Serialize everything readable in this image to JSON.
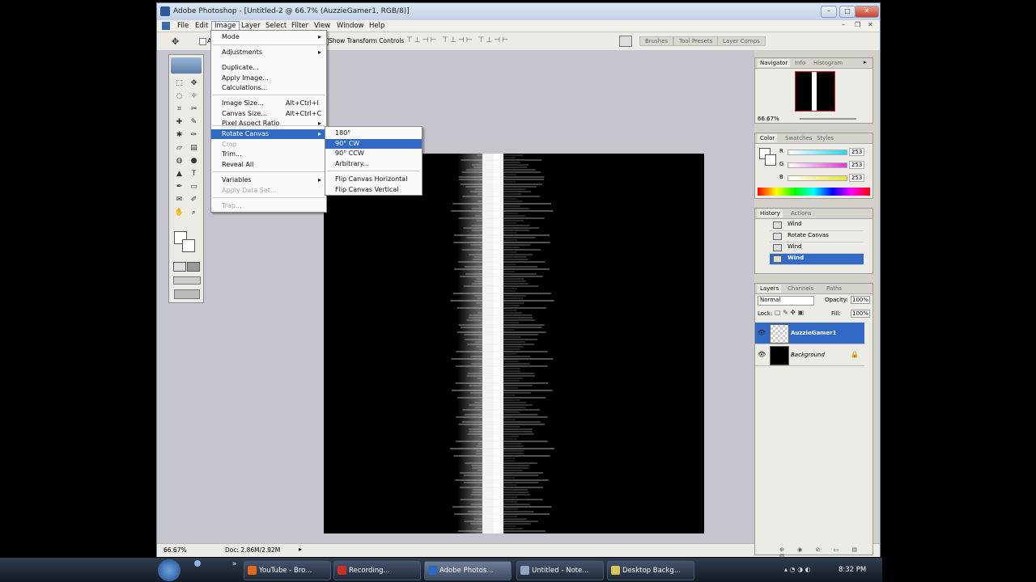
{
  "window": {
    "title": "Adobe Photoshop - [Untitled-2 @ 66.7% (AuzzieGamer1, RGB/8)]",
    "min": "–",
    "max": "□",
    "close": "✕"
  },
  "doc_controls": {
    "min": "–",
    "restore": "❐",
    "close": "✕"
  },
  "menubar": [
    "File",
    "Edit",
    "Image",
    "Layer",
    "Select",
    "Filter",
    "View",
    "Window",
    "Help"
  ],
  "options": {
    "show_transform": "Show Transform Controls",
    "auto_prefix": "A",
    "tabs": [
      "Brushes",
      "Tool Presets",
      "Layer Comps"
    ]
  },
  "image_menu": {
    "items": [
      {
        "label": "Mode",
        "arrow": "▸"
      },
      {
        "label": "Adjustments",
        "arrow": "▸"
      },
      {
        "label": "Duplicate..."
      },
      {
        "label": "Apply Image..."
      },
      {
        "label": "Calculations..."
      },
      {
        "label": "Image Size...",
        "shortcut": "Alt+Ctrl+I"
      },
      {
        "label": "Canvas Size...",
        "shortcut": "Alt+Ctrl+C"
      },
      {
        "label": "Pixel Aspect Ratio",
        "arrow": "▸"
      },
      {
        "label": "Rotate Canvas",
        "arrow": "▸"
      },
      {
        "label": "Crop"
      },
      {
        "label": "Trim..."
      },
      {
        "label": "Reveal All"
      },
      {
        "label": "Variables",
        "arrow": "▸"
      },
      {
        "label": "Apply Data Set..."
      },
      {
        "label": "Trap..."
      }
    ]
  },
  "rotate_submenu": {
    "items": [
      "180°",
      "90° CW",
      "90° CCW",
      "Arbitrary...",
      "Flip Canvas Horizontal",
      "Flip Canvas Vertical"
    ]
  },
  "navigator": {
    "tabs": [
      "Navigator",
      "Info",
      "Histogram"
    ],
    "zoom": "66.67%"
  },
  "color": {
    "tabs": [
      "Color",
      "Swatches",
      "Styles"
    ],
    "channels": [
      {
        "name": "R",
        "value": "253",
        "color": "#27d6e8"
      },
      {
        "name": "G",
        "value": "253",
        "color": "#e03ad5"
      },
      {
        "name": "B",
        "value": "253",
        "color": "#e8e23a"
      }
    ]
  },
  "history": {
    "tabs": [
      "History",
      "Actions"
    ],
    "states": [
      "Wind",
      "Rotate Canvas",
      "Wind",
      "Wind"
    ]
  },
  "layers": {
    "tabs": [
      "Layers",
      "Channels",
      "Paths"
    ],
    "blend_mode": "Normal",
    "opacity_label": "Opacity:",
    "opacity": "100%",
    "lock_label": "Lock:",
    "fill_label": "Fill:",
    "fill": "100%",
    "items": [
      {
        "name": "AuzzieGamer1",
        "selected": true
      },
      {
        "name": "Background",
        "selected": false
      }
    ]
  },
  "status": {
    "zoom": "66.67%",
    "doc": "Doc: 2.86M/2.92M"
  },
  "taskbar": {
    "tasks": [
      "YouTube - Bro...",
      "Recording...",
      "Adobe Photos...",
      "Untitled - Note...",
      "Desktop Backg..."
    ],
    "time": "8:32 PM",
    "chevron": "»"
  }
}
